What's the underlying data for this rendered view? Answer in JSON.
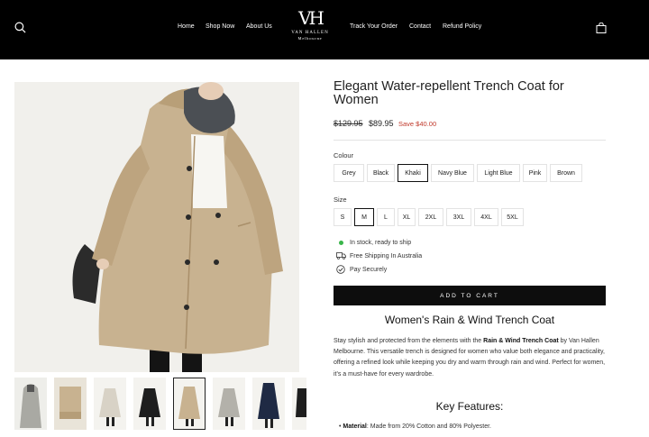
{
  "header": {
    "nav_left": [
      "Home",
      "Shop Now",
      "About Us"
    ],
    "nav_right": [
      "Track Your Order",
      "Contact",
      "Refund Policy"
    ],
    "logo": {
      "monogram": "VH",
      "name": "VAN HALLEN",
      "sub": "Melbourne"
    }
  },
  "product": {
    "title": "Elegant Water-repellent Trench Coat for Women",
    "price_old": "$129.95",
    "price_new": "$89.95",
    "save": "Save $40.00",
    "colour_label": "Colour",
    "colours": [
      "Grey",
      "Black",
      "Khaki",
      "Navy Blue",
      "Light Blue",
      "Pink",
      "Brown"
    ],
    "selected_colour": "Khaki",
    "size_label": "Size",
    "sizes": [
      "S",
      "M",
      "L",
      "XL",
      "2XL",
      "3XL",
      "4XL",
      "5XL"
    ],
    "selected_size": "M",
    "features": [
      "In stock, ready to ship",
      "Free Shipping In Australia",
      "Pay Securely"
    ],
    "add_to_cart": "ADD TO CART"
  },
  "description": {
    "heading": "Women's Rain & Wind Trench Coat",
    "text_before": "Stay stylish and protected from the elements with the ",
    "text_bold": "Rain & Wind Trench Coat",
    "text_after": " by Van Hallen Melbourne. This versatile trench is designed for women who value both elegance and practicality, offering a refined look while keeping you dry and warm through rain and wind. Perfect for women, it's a must-have for every wardrobe.",
    "key_features_heading": "Key Features:",
    "feature_bold": "Material",
    "feature_text": ": Made from 20% Cotton and 80% Polyester."
  },
  "colors": {
    "header_bg": "#000000",
    "accent_green": "#3ab54a",
    "save_red": "#c0392b",
    "coat": "#c8b290"
  },
  "icons": {
    "search": "search-icon",
    "cart": "shopping-bag-icon",
    "stock": "status-dot-icon",
    "shipping": "truck-icon",
    "secure": "shield-check-icon"
  }
}
